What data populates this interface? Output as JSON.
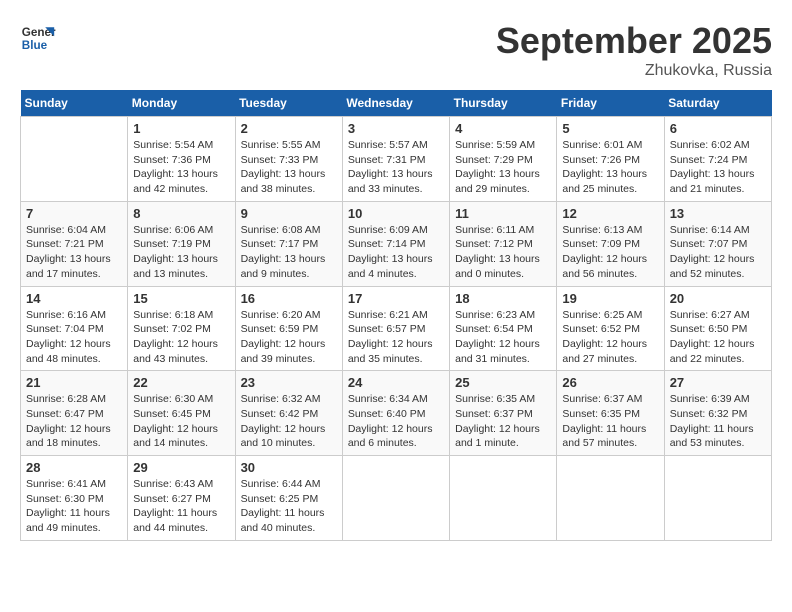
{
  "header": {
    "logo_line1": "General",
    "logo_line2": "Blue",
    "month": "September 2025",
    "location": "Zhukovka, Russia"
  },
  "weekdays": [
    "Sunday",
    "Monday",
    "Tuesday",
    "Wednesday",
    "Thursday",
    "Friday",
    "Saturday"
  ],
  "weeks": [
    [
      {
        "day": "",
        "info": ""
      },
      {
        "day": "1",
        "info": "Sunrise: 5:54 AM\nSunset: 7:36 PM\nDaylight: 13 hours\nand 42 minutes."
      },
      {
        "day": "2",
        "info": "Sunrise: 5:55 AM\nSunset: 7:33 PM\nDaylight: 13 hours\nand 38 minutes."
      },
      {
        "day": "3",
        "info": "Sunrise: 5:57 AM\nSunset: 7:31 PM\nDaylight: 13 hours\nand 33 minutes."
      },
      {
        "day": "4",
        "info": "Sunrise: 5:59 AM\nSunset: 7:29 PM\nDaylight: 13 hours\nand 29 minutes."
      },
      {
        "day": "5",
        "info": "Sunrise: 6:01 AM\nSunset: 7:26 PM\nDaylight: 13 hours\nand 25 minutes."
      },
      {
        "day": "6",
        "info": "Sunrise: 6:02 AM\nSunset: 7:24 PM\nDaylight: 13 hours\nand 21 minutes."
      }
    ],
    [
      {
        "day": "7",
        "info": "Sunrise: 6:04 AM\nSunset: 7:21 PM\nDaylight: 13 hours\nand 17 minutes."
      },
      {
        "day": "8",
        "info": "Sunrise: 6:06 AM\nSunset: 7:19 PM\nDaylight: 13 hours\nand 13 minutes."
      },
      {
        "day": "9",
        "info": "Sunrise: 6:08 AM\nSunset: 7:17 PM\nDaylight: 13 hours\nand 9 minutes."
      },
      {
        "day": "10",
        "info": "Sunrise: 6:09 AM\nSunset: 7:14 PM\nDaylight: 13 hours\nand 4 minutes."
      },
      {
        "day": "11",
        "info": "Sunrise: 6:11 AM\nSunset: 7:12 PM\nDaylight: 13 hours\nand 0 minutes."
      },
      {
        "day": "12",
        "info": "Sunrise: 6:13 AM\nSunset: 7:09 PM\nDaylight: 12 hours\nand 56 minutes."
      },
      {
        "day": "13",
        "info": "Sunrise: 6:14 AM\nSunset: 7:07 PM\nDaylight: 12 hours\nand 52 minutes."
      }
    ],
    [
      {
        "day": "14",
        "info": "Sunrise: 6:16 AM\nSunset: 7:04 PM\nDaylight: 12 hours\nand 48 minutes."
      },
      {
        "day": "15",
        "info": "Sunrise: 6:18 AM\nSunset: 7:02 PM\nDaylight: 12 hours\nand 43 minutes."
      },
      {
        "day": "16",
        "info": "Sunrise: 6:20 AM\nSunset: 6:59 PM\nDaylight: 12 hours\nand 39 minutes."
      },
      {
        "day": "17",
        "info": "Sunrise: 6:21 AM\nSunset: 6:57 PM\nDaylight: 12 hours\nand 35 minutes."
      },
      {
        "day": "18",
        "info": "Sunrise: 6:23 AM\nSunset: 6:54 PM\nDaylight: 12 hours\nand 31 minutes."
      },
      {
        "day": "19",
        "info": "Sunrise: 6:25 AM\nSunset: 6:52 PM\nDaylight: 12 hours\nand 27 minutes."
      },
      {
        "day": "20",
        "info": "Sunrise: 6:27 AM\nSunset: 6:50 PM\nDaylight: 12 hours\nand 22 minutes."
      }
    ],
    [
      {
        "day": "21",
        "info": "Sunrise: 6:28 AM\nSunset: 6:47 PM\nDaylight: 12 hours\nand 18 minutes."
      },
      {
        "day": "22",
        "info": "Sunrise: 6:30 AM\nSunset: 6:45 PM\nDaylight: 12 hours\nand 14 minutes."
      },
      {
        "day": "23",
        "info": "Sunrise: 6:32 AM\nSunset: 6:42 PM\nDaylight: 12 hours\nand 10 minutes."
      },
      {
        "day": "24",
        "info": "Sunrise: 6:34 AM\nSunset: 6:40 PM\nDaylight: 12 hours\nand 6 minutes."
      },
      {
        "day": "25",
        "info": "Sunrise: 6:35 AM\nSunset: 6:37 PM\nDaylight: 12 hours\nand 1 minute."
      },
      {
        "day": "26",
        "info": "Sunrise: 6:37 AM\nSunset: 6:35 PM\nDaylight: 11 hours\nand 57 minutes."
      },
      {
        "day": "27",
        "info": "Sunrise: 6:39 AM\nSunset: 6:32 PM\nDaylight: 11 hours\nand 53 minutes."
      }
    ],
    [
      {
        "day": "28",
        "info": "Sunrise: 6:41 AM\nSunset: 6:30 PM\nDaylight: 11 hours\nand 49 minutes."
      },
      {
        "day": "29",
        "info": "Sunrise: 6:43 AM\nSunset: 6:27 PM\nDaylight: 11 hours\nand 44 minutes."
      },
      {
        "day": "30",
        "info": "Sunrise: 6:44 AM\nSunset: 6:25 PM\nDaylight: 11 hours\nand 40 minutes."
      },
      {
        "day": "",
        "info": ""
      },
      {
        "day": "",
        "info": ""
      },
      {
        "day": "",
        "info": ""
      },
      {
        "day": "",
        "info": ""
      }
    ]
  ]
}
